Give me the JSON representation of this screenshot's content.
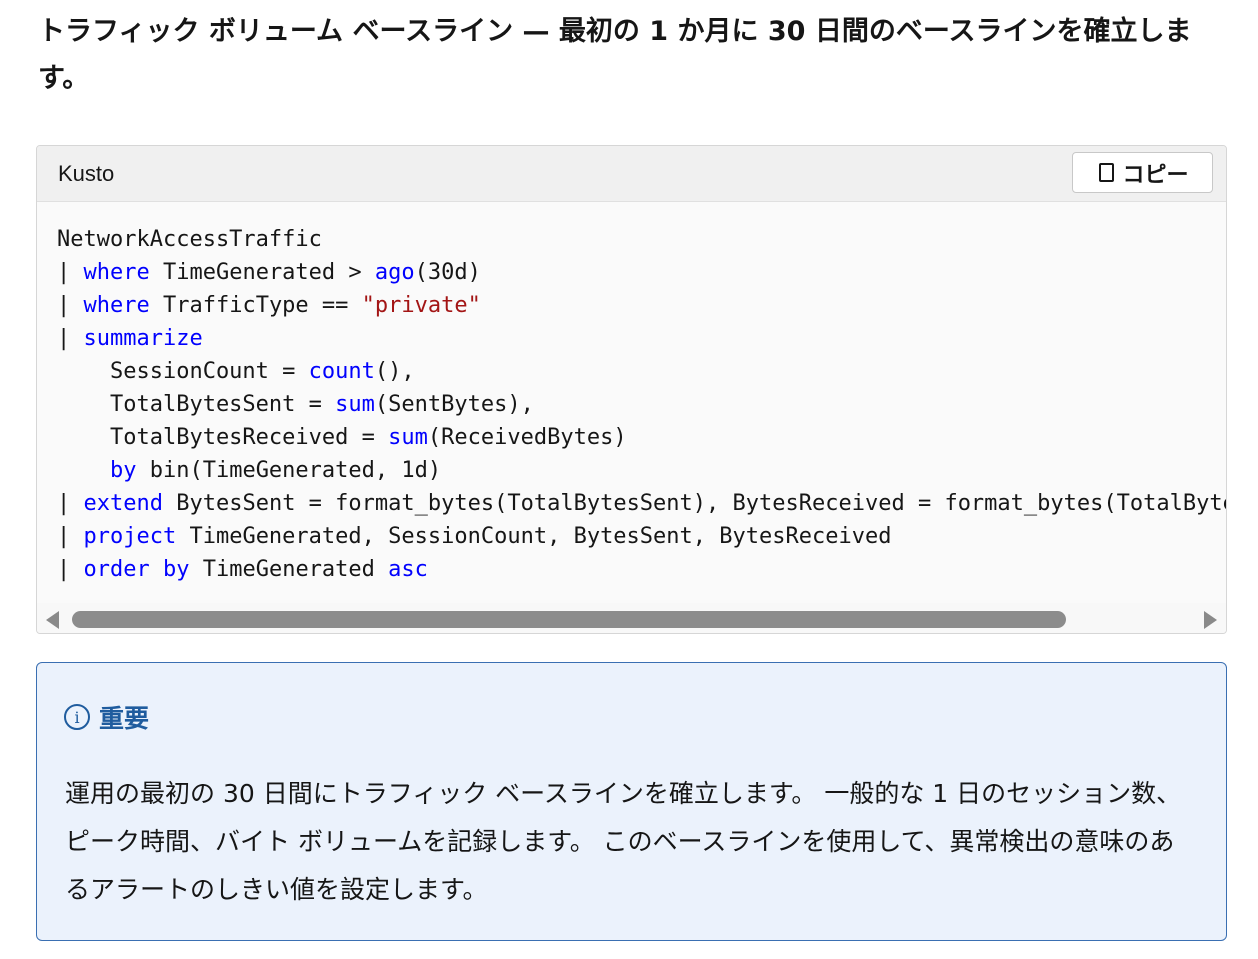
{
  "heading": "トラフィック ボリューム ベースライン — 最初の 1 か月に 30 日間のベースラインを確立します。",
  "code_block": {
    "language": "Kusto",
    "copy_label": "コピー",
    "lines": [
      [
        {
          "t": "NetworkAccessTraffic"
        }
      ],
      [
        {
          "t": "| "
        },
        {
          "t": "where",
          "c": "kw"
        },
        {
          "t": " TimeGenerated > "
        },
        {
          "t": "ago",
          "c": "kw"
        },
        {
          "t": "(30d)"
        }
      ],
      [
        {
          "t": "| "
        },
        {
          "t": "where",
          "c": "kw"
        },
        {
          "t": " TrafficType == "
        },
        {
          "t": "\"private\"",
          "c": "str"
        }
      ],
      [
        {
          "t": "| "
        },
        {
          "t": "summarize",
          "c": "kw"
        }
      ],
      [
        {
          "t": "    SessionCount = "
        },
        {
          "t": "count",
          "c": "kw"
        },
        {
          "t": "(),"
        }
      ],
      [
        {
          "t": "    TotalBytesSent = "
        },
        {
          "t": "sum",
          "c": "kw"
        },
        {
          "t": "(SentBytes),"
        }
      ],
      [
        {
          "t": "    TotalBytesReceived = "
        },
        {
          "t": "sum",
          "c": "kw"
        },
        {
          "t": "(ReceivedBytes)"
        }
      ],
      [
        {
          "t": "    "
        },
        {
          "t": "by",
          "c": "kw"
        },
        {
          "t": " bin(TimeGenerated, 1d)"
        }
      ],
      [
        {
          "t": "| "
        },
        {
          "t": "extend",
          "c": "kw"
        },
        {
          "t": " BytesSent = format_bytes(TotalBytesSent), BytesReceived = format_bytes(TotalBytesReceived)"
        }
      ],
      [
        {
          "t": "| "
        },
        {
          "t": "project",
          "c": "kw"
        },
        {
          "t": " TimeGenerated, SessionCount, BytesSent, BytesReceived"
        }
      ],
      [
        {
          "t": "| "
        },
        {
          "t": "order",
          "c": "kw"
        },
        {
          "t": " "
        },
        {
          "t": "by",
          "c": "kw"
        },
        {
          "t": " TimeGenerated "
        },
        {
          "t": "asc",
          "c": "kw"
        }
      ]
    ]
  },
  "alert": {
    "title": "重要",
    "icon": "info-icon",
    "text": "運用の最初の 30 日間にトラフィック ベースラインを確立します。 一般的な 1 日のセッション数、ピーク時間、バイト ボリュームを記録します。 このベースラインを使用して、異常検出の意味のあるアラートのしきい値を設定します。"
  },
  "colors": {
    "keyword": "#0101fd",
    "string": "#a31515",
    "alert_border": "#3a6fb2",
    "alert_background": "#ebf2fc"
  }
}
